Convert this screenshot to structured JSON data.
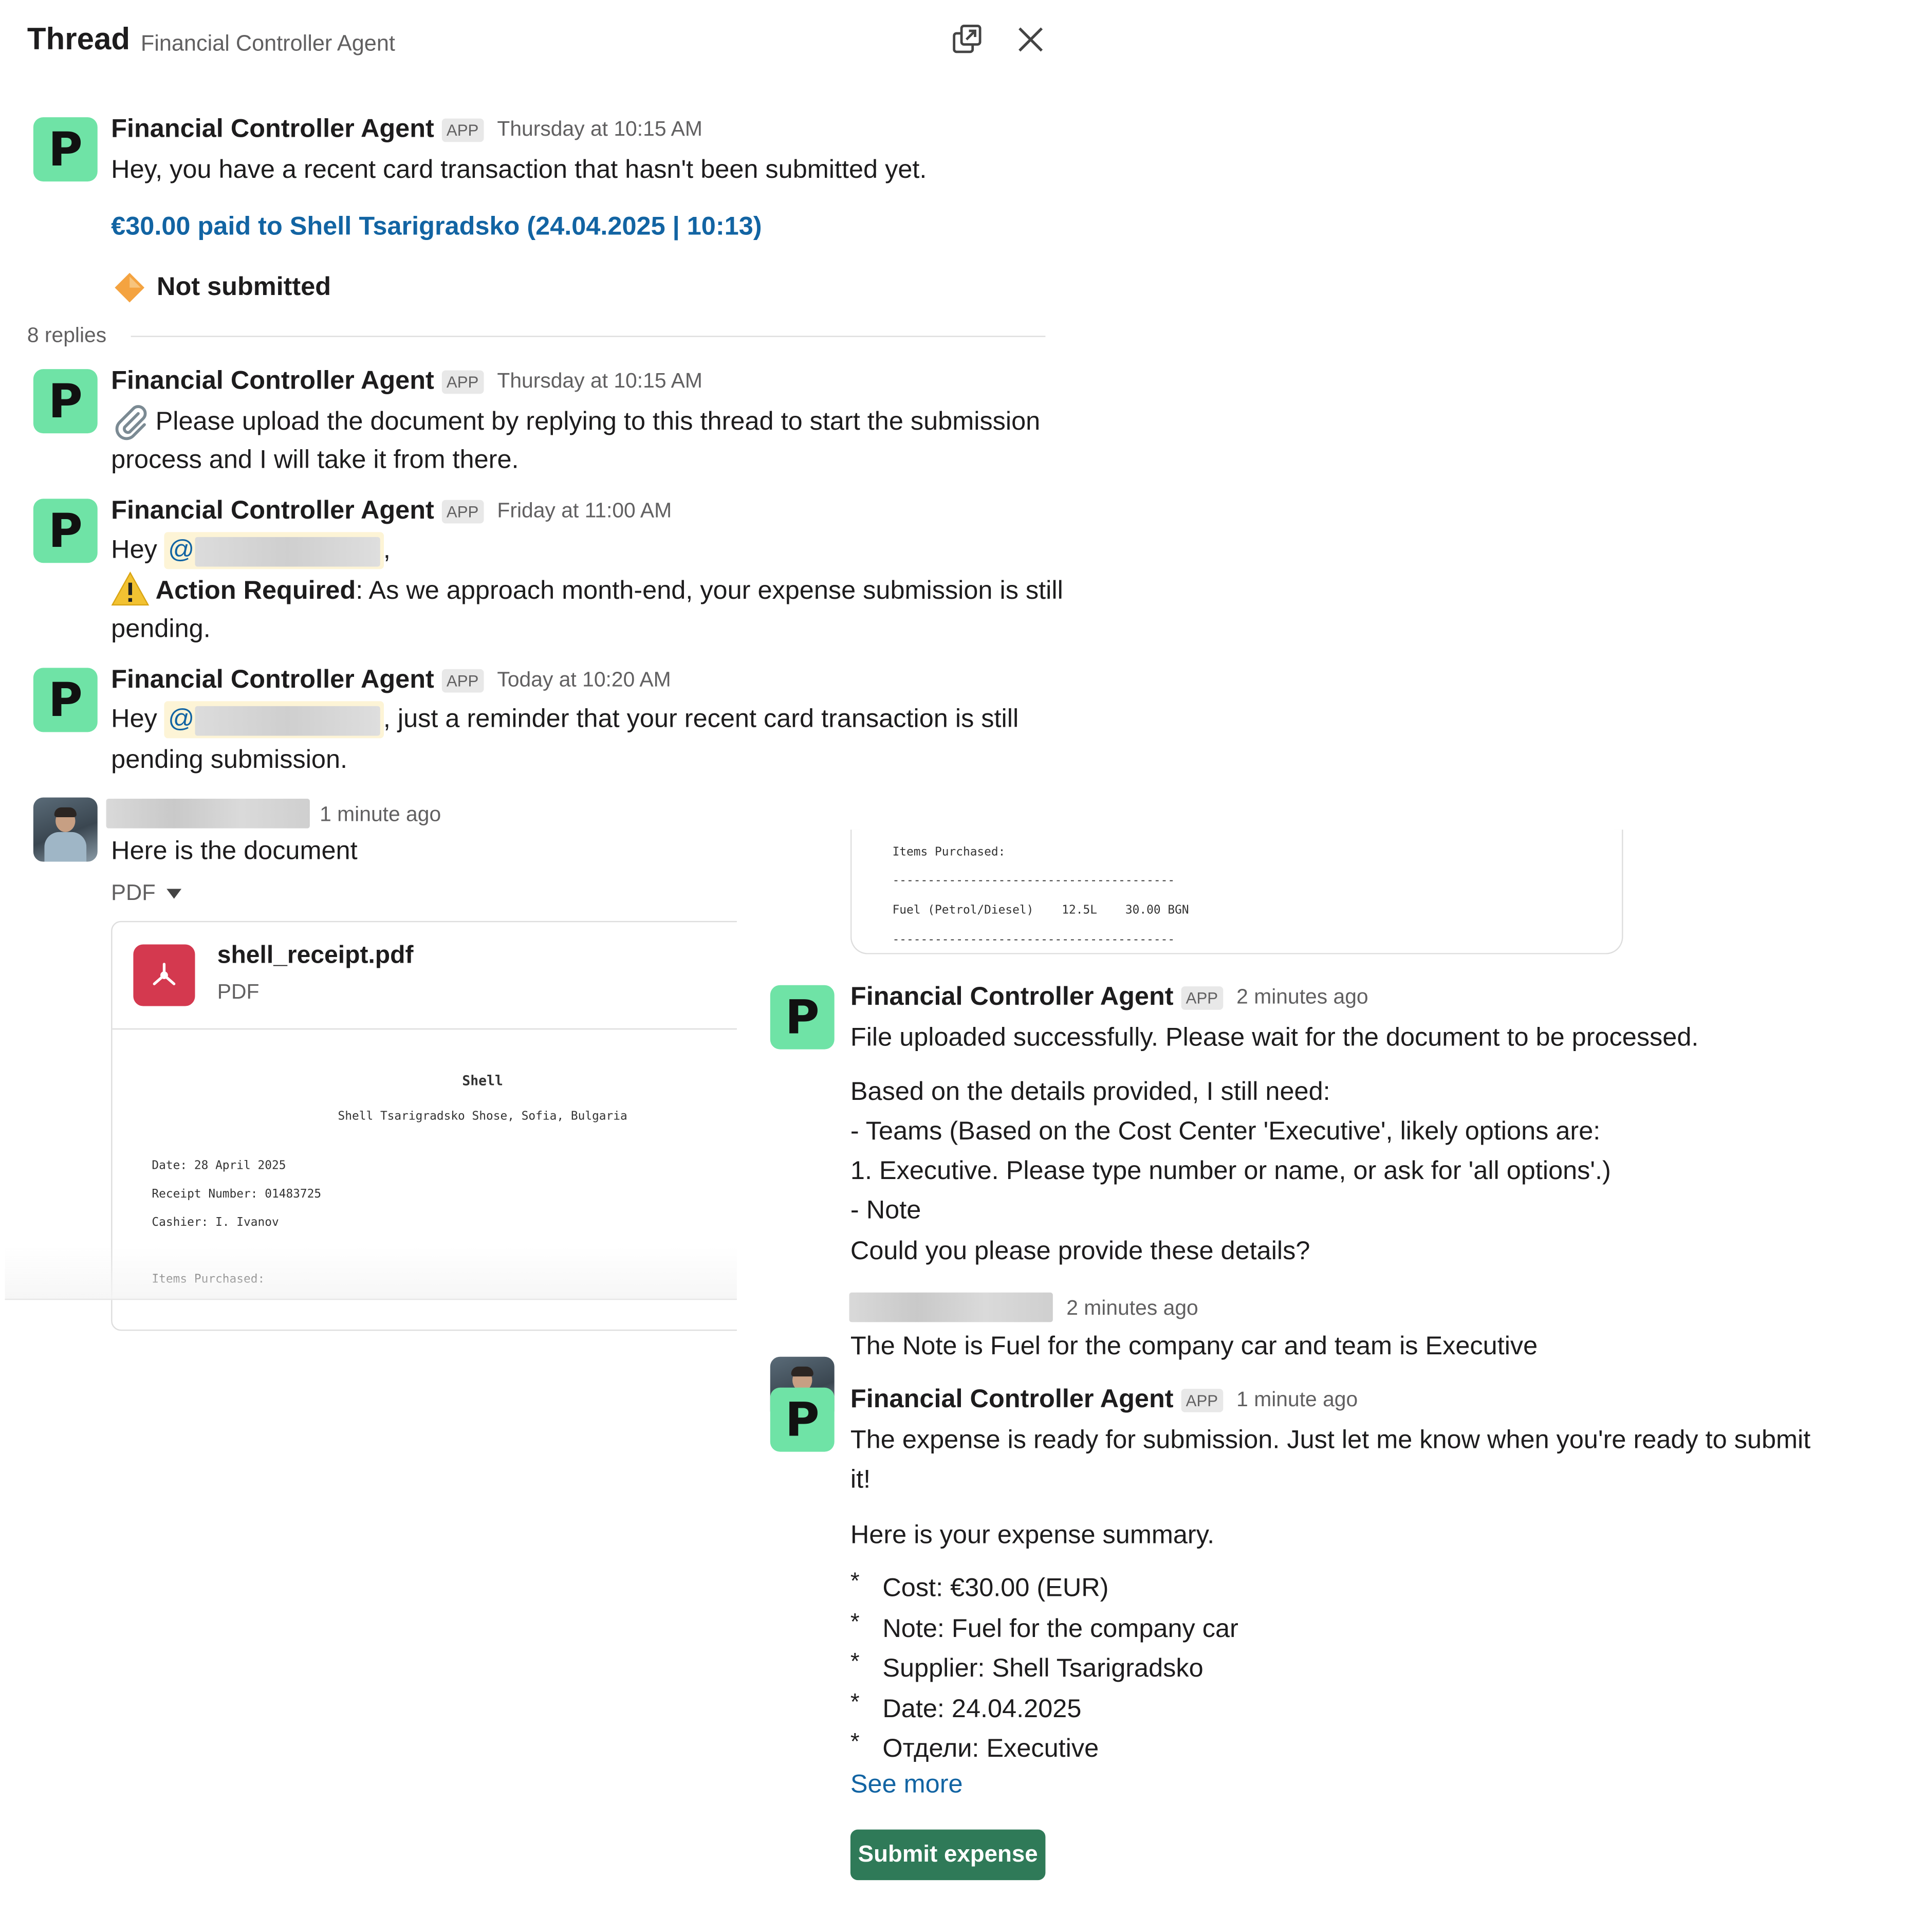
{
  "header": {
    "title": "Thread",
    "subtitle": "Financial Controller Agent"
  },
  "agent": {
    "name": "Financial Controller Agent",
    "badge": "APP",
    "avatar_letter": "P",
    "avatar_color": "#6fe3a6"
  },
  "root_message": {
    "time": "Thursday at 10:15 AM",
    "text": "Hey, you have a recent card transaction that hasn't been submitted yet.",
    "link": "€30.00 paid to Shell Tsarigradsko (24.04.2025 | 10:13)",
    "status": "Not submitted"
  },
  "replies_count": "8 replies",
  "messages": {
    "m1": {
      "time": "Thursday at 10:15 AM",
      "line1": "Please upload the document by replying to this thread to start the submission",
      "line2": "process and I will take it from there."
    },
    "m2": {
      "time": "Friday at 11:00 AM",
      "hey": "Hey",
      "at": "@",
      "comma": ",",
      "action_bold": "Action Required",
      "action_rest": ": As we approach month-end, your expense submission is still",
      "line3": "pending."
    },
    "m3": {
      "time": "Today at 10:20 AM",
      "hey": "Hey",
      "at": "@",
      "rest": ", just a reminder that your recent card transaction is still",
      "line2": "pending submission."
    },
    "user1": {
      "time": "1 minute ago",
      "text": "Here is the document",
      "file_type_toggle": "PDF",
      "file_name": "shell_receipt.pdf",
      "file_kind": "PDF"
    },
    "m5": {
      "time": "2 minutes ago",
      "line1": "File uploaded successfully. Please wait for the document to be processed.",
      "line2": "Based on the details provided, I still need:",
      "line3": "- Teams (Based on the Cost Center 'Executive', likely options are:",
      "line4": "1. Executive. Please type number or name, or ask for 'all options'.)",
      "line5": "- Note",
      "line6": "Could you please provide these details?"
    },
    "user2": {
      "time": "2 minutes ago",
      "text": "The Note is Fuel for the company car and team is Executive"
    },
    "m7": {
      "time": "1 minute ago",
      "line1": "The expense is ready for submission. Just let me know when you're ready to submit",
      "line2": "it!",
      "summary_intro": "Here is your expense summary.",
      "bullets": [
        "Cost: €30.00 (EUR)",
        "Note: Fuel for the company car",
        "Supplier: Shell Tsarigradsko",
        "Date: 24.04.2025",
        "Отдели: Executive"
      ],
      "bullet_marker": "*",
      "see_more": "See more",
      "submit_label": "Submit expense"
    }
  },
  "receipt": {
    "title": "Shell",
    "address": "Shell Tsarigradsko Shose, Sofia, Bulgaria",
    "date": "Date: 28 April 2025",
    "receipt_number": "Receipt Number: 01483725",
    "cashier": "Cashier: I. Ivanov",
    "items_heading": "Items Purchased:",
    "separator": "----------------------------------------",
    "item_line": "Fuel (Petrol/Diesel)    12.5L    30.00 BGN"
  },
  "icons": {
    "popout": "popout-icon",
    "close": "close-icon",
    "status": "orange-diamond-icon",
    "paperclip": "paperclip-icon",
    "warning": "warning-icon",
    "caret": "caret-down-icon",
    "pdf": "pdf-icon"
  },
  "colors": {
    "link": "#1264a3",
    "submit": "#2f7a58",
    "pdf": "#d4394f",
    "mention_bg": "#fdf4d6"
  }
}
